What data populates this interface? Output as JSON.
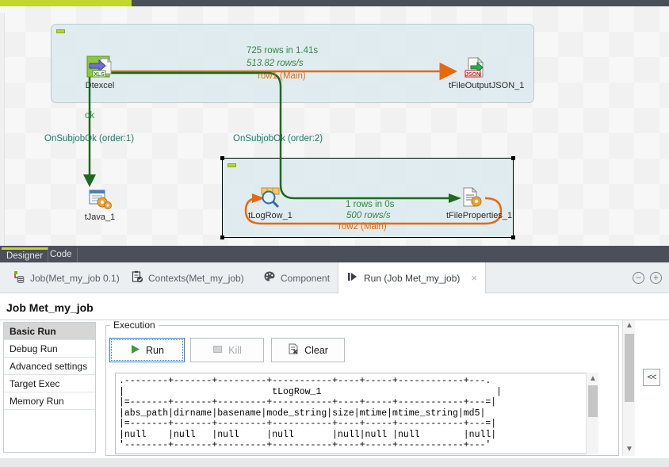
{
  "top_bar": {
    "accent_color": "#c3d62b",
    "track_color": "#4a4f59"
  },
  "designer": {
    "subjobs": [
      {
        "id": "subjob1",
        "selected": false
      },
      {
        "id": "subjob2",
        "selected": true
      }
    ],
    "nodes": [
      {
        "name": "Dtexcel",
        "icon": "xls-input-icon"
      },
      {
        "name": "tFileOutputJSON_1",
        "icon": "json-output-icon"
      },
      {
        "name": "tJava_1",
        "icon": "tjava-icon"
      },
      {
        "name": "tLogRow_1",
        "icon": "tlogrow-icon"
      },
      {
        "name": "tFileProperties_1",
        "icon": "tfileproperties-icon"
      }
    ],
    "connections": [
      {
        "id": "row1",
        "rows_time": "725 rows in 1.41s",
        "rate": "513.82 rows/s",
        "label": "row1 (Main)"
      },
      {
        "id": "row2",
        "rows_time": "1 rows in 0s",
        "rate": "500 rows/s",
        "label": "row2 (Main)"
      }
    ],
    "triggers": [
      {
        "label": "ok",
        "sublabel": "OnSubjobOk (order:1)"
      },
      {
        "label": "",
        "sublabel": "OnSubjobOk (order:2)"
      }
    ],
    "colors": {
      "main_flow": "#e8690b",
      "trigger": "#1b6b1b",
      "metrics": "#2d8a3e",
      "subjob_fill": "#dbe9f0",
      "subjob_border": "#b6cbd8"
    }
  },
  "editor_tabs": [
    {
      "label": "Designer",
      "active": true
    },
    {
      "label": "Code",
      "active": false
    }
  ],
  "view_tabs": [
    {
      "label": "Job(Met_my_job 0.1)",
      "icon": "job-icon",
      "active": false
    },
    {
      "label": "Contexts(Met_my_job)",
      "icon": "contexts-icon",
      "active": false
    },
    {
      "label": "Component",
      "icon": "palette-icon",
      "active": false
    },
    {
      "label": "Run (Job Met_my_job)",
      "icon": "run-icon",
      "active": true,
      "close": "×"
    }
  ],
  "zoom_controls": {
    "minus": "−",
    "plus": "+"
  },
  "run_view": {
    "title": "Job Met_my_job",
    "nav_items": [
      {
        "label": "Basic Run",
        "active": true
      },
      {
        "label": "Debug Run",
        "active": false
      },
      {
        "label": "Advanced settings",
        "active": false
      },
      {
        "label": "Target Exec",
        "active": false
      },
      {
        "label": "Memory Run",
        "active": false
      }
    ],
    "group_legend": "Execution",
    "buttons": [
      {
        "label": "Run",
        "icon": "play-icon",
        "state": "focused"
      },
      {
        "label": "Kill",
        "icon": "stop-icon",
        "state": "disabled"
      },
      {
        "label": "Clear",
        "icon": "clear-icon",
        "state": "normal"
      }
    ],
    "console_output": ".--------+-------+---------+-----------+----+-----+------------+---.\n|                           tLogRow_1                                |\n|=-------+-------+---------+-----------+----+-----+------------+---=|\n|abs_path|dirname|basename|mode_string|size|mtime|mtime_string|md5|\n|=-------+-------+---------+-----------+----+-----+------------+---=|\n|null    |null   |null     |null       |null|null |null        |null|\n'--------+-------+---------+-----------+----+-----+------------+---'"
  },
  "collapse_button": {
    "label": "<<"
  }
}
